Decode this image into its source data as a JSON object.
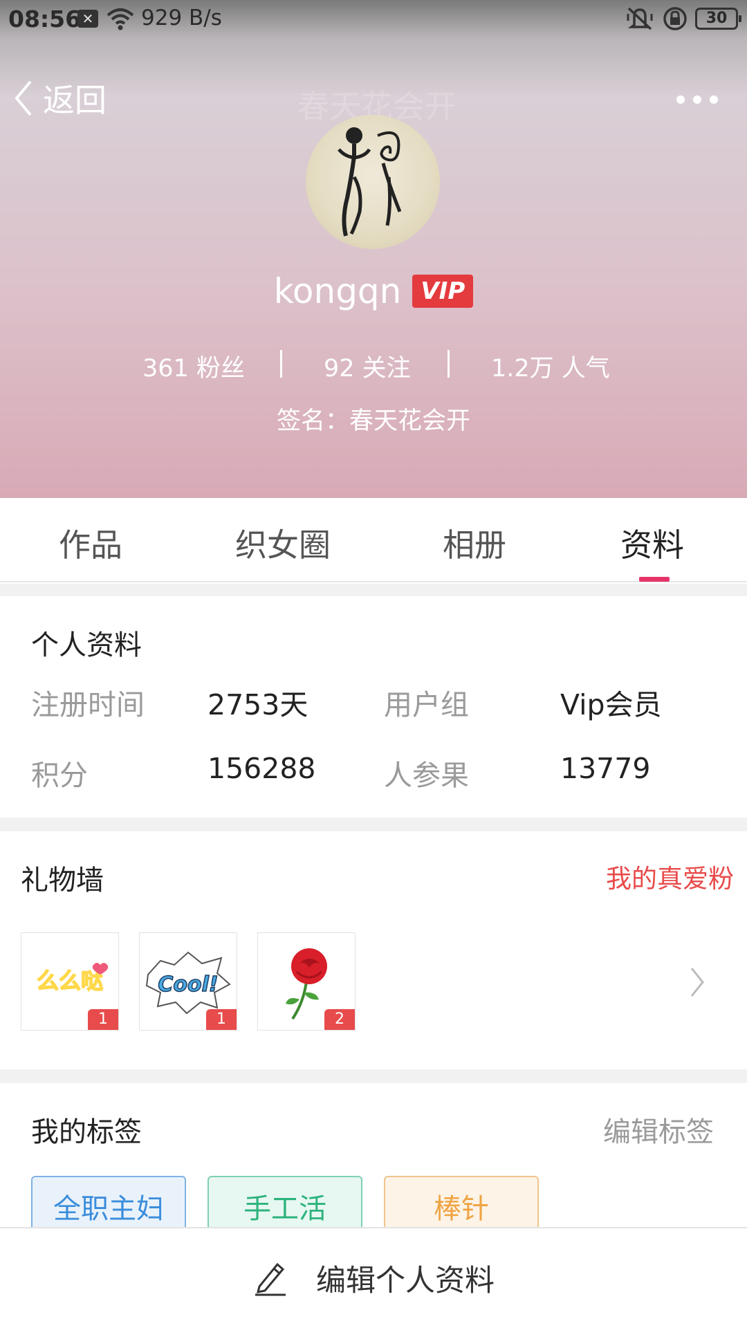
{
  "status_bar": {
    "time": "08:56",
    "network_speed": "929 B/s",
    "battery": "30",
    "icons": [
      "notification-x-icon",
      "wifi-icon",
      "mute-icon",
      "rotation-lock-icon",
      "battery-icon"
    ]
  },
  "header": {
    "back_label": "返回",
    "faint_title": "春天花会开",
    "username": "kongqn",
    "vip_badge": "VIP",
    "stats": {
      "fans": "361 粉丝",
      "following": "92 关注",
      "popularity": "1.2万 人气"
    },
    "signature": "签名：春天花会开"
  },
  "tabs": [
    {
      "label": "作品",
      "active": false
    },
    {
      "label": "织女圈",
      "active": false
    },
    {
      "label": "相册",
      "active": false
    },
    {
      "label": "资料",
      "active": true
    }
  ],
  "profile": {
    "title": "个人资料",
    "fields": [
      {
        "label": "注册时间",
        "value": "2753天"
      },
      {
        "label": "用户组",
        "value": "Vip会员"
      },
      {
        "label": "积分",
        "value": "156288"
      },
      {
        "label": "人参果",
        "value": "13779"
      }
    ]
  },
  "gifts": {
    "title": "礼物墙",
    "link_label": "我的真爱粉",
    "items": [
      {
        "name": "么么哒",
        "count": "1"
      },
      {
        "name": "Cool!",
        "count": "1"
      },
      {
        "name": "rose",
        "count": "2"
      }
    ]
  },
  "tags": {
    "title": "我的标签",
    "edit_label": "编辑标签",
    "items": [
      "全职主妇",
      "手工活",
      "棒针"
    ],
    "colors": {
      "blue": "#3b8ddb",
      "green": "#2bb37c",
      "orange": "#efa443"
    }
  },
  "bottom_bar": {
    "edit_profile_label": "编辑个人资料"
  },
  "colors": {
    "accent": "#e8336a",
    "vip_red": "#e43b3f",
    "gift_link": "#e84b4b"
  }
}
